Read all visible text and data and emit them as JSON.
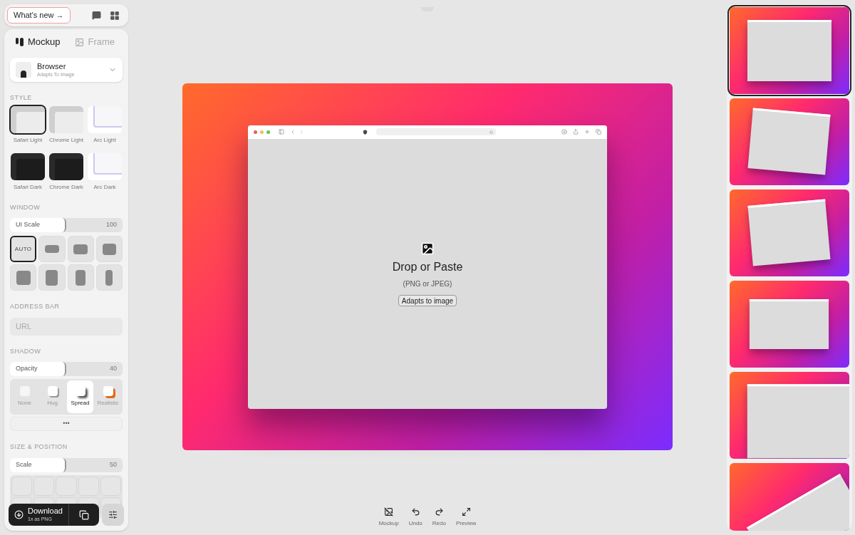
{
  "header": {
    "whats_new": "What's new →"
  },
  "tabs": [
    {
      "label": "Mockup",
      "selected": true
    },
    {
      "label": "Frame",
      "selected": false
    }
  ],
  "device": {
    "name": "Browser",
    "subtitle": "Adapts To Image"
  },
  "style": {
    "heading": "STYLE",
    "options": [
      {
        "label": "Safari Light",
        "kind": "light",
        "selected": true
      },
      {
        "label": "Chrome Light",
        "kind": "light",
        "selected": false
      },
      {
        "label": "Arc Light",
        "kind": "arc",
        "selected": false
      },
      {
        "label": "Safari Dark",
        "kind": "dark",
        "selected": false
      },
      {
        "label": "Chrome Dark",
        "kind": "dark",
        "selected": false
      },
      {
        "label": "Arc Dark",
        "kind": "arc",
        "selected": false
      }
    ]
  },
  "window": {
    "heading": "WINDOW",
    "slider": {
      "label": "UI Scale",
      "reading": "100",
      "level": 0.5
    },
    "sizes": [
      {
        "label": "AUTO",
        "selected": true
      },
      {
        "selected": false
      },
      {
        "selected": false
      },
      {
        "selected": false
      },
      {
        "selected": false
      },
      {
        "selected": false
      },
      {
        "selected": false
      },
      {
        "selected": false
      }
    ]
  },
  "address_bar": {
    "heading": "ADDRESS BAR",
    "placeholder": "URL"
  },
  "shadow": {
    "heading": "SHADOW",
    "slider": {
      "label": "Opacity",
      "reading": "40",
      "level": 0.5
    },
    "options": [
      {
        "label": "None",
        "selected": false
      },
      {
        "label": "Hug",
        "selected": false
      },
      {
        "label": "Spread",
        "selected": true
      },
      {
        "label": "Realistic",
        "selected": false
      }
    ],
    "more": "•••"
  },
  "size_position": {
    "heading": "SIZE & POSITION",
    "slider": {
      "label": "Scale",
      "reading": "50",
      "level": 0.5
    }
  },
  "download": {
    "label": "Download",
    "sublabel": "1x as PNG"
  },
  "canvas": {
    "title": "Drop or Paste",
    "hint": "(PNG or JPEG)",
    "button": "Adapts to image"
  },
  "toolbar": [
    {
      "label": "Mockup",
      "kind": "mockup"
    },
    {
      "label": "Undo",
      "kind": "undo"
    },
    {
      "label": "Redo",
      "kind": "redo"
    },
    {
      "label": "Preview",
      "kind": "preview"
    }
  ],
  "presets": [
    {
      "selected": true
    },
    {
      "selected": false
    },
    {
      "selected": false
    },
    {
      "selected": false
    },
    {
      "selected": false
    },
    {
      "selected": false
    }
  ]
}
